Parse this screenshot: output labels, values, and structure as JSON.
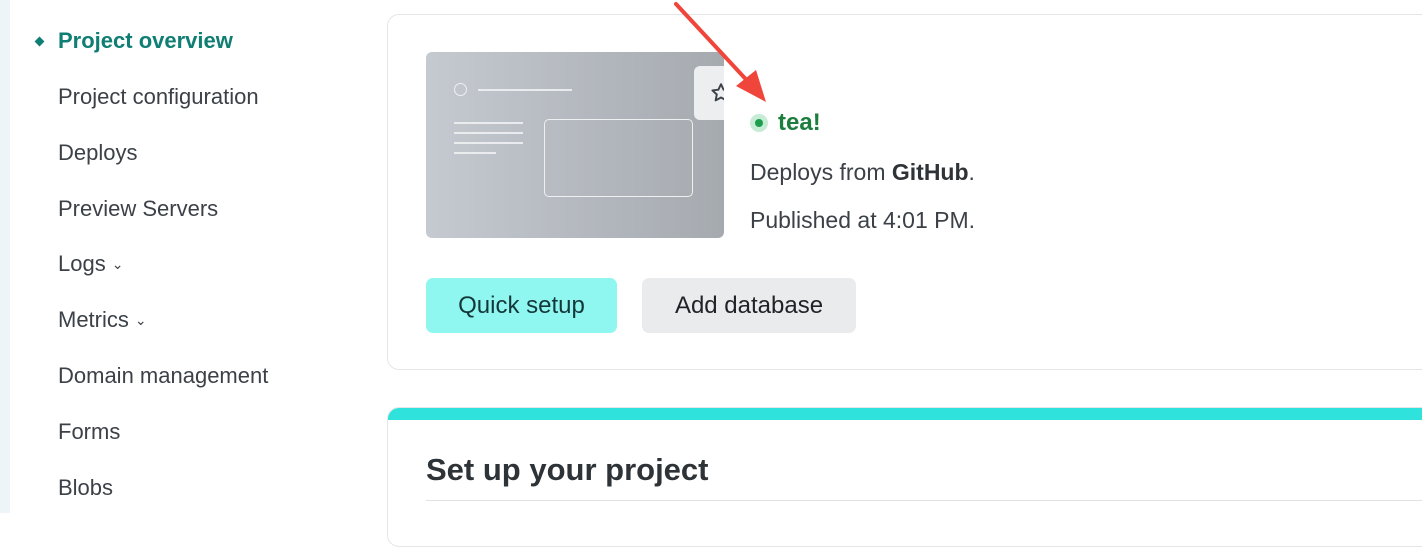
{
  "sidebar": {
    "items": [
      {
        "label": "Project overview",
        "active": true
      },
      {
        "label": "Project configuration"
      },
      {
        "label": "Deploys"
      },
      {
        "label": "Preview Servers"
      },
      {
        "label": "Logs",
        "chevron": "chevron-down-icon"
      },
      {
        "label": "Metrics",
        "chevron": "chevron-down-icon"
      },
      {
        "label": "Domain management"
      },
      {
        "label": "Forms"
      },
      {
        "label": "Blobs"
      }
    ]
  },
  "overview": {
    "site_name": "tea!",
    "deploys_prefix": "Deploys from ",
    "deploys_source": "GitHub",
    "deploys_suffix": ".",
    "published": "Published at 4:01 PM.",
    "quick_setup_label": "Quick setup",
    "add_database_label": "Add database",
    "favorite_icon": "star-icon",
    "status_icon": "status-dot-icon"
  },
  "setup": {
    "title": "Set up your project"
  },
  "colors": {
    "accent": "#0f7e74",
    "status_green": "#1b7e3c",
    "primary_button": "#8ff7f0",
    "setup_bar": "#2fe3dc",
    "annotation_arrow": "#f0453a"
  }
}
